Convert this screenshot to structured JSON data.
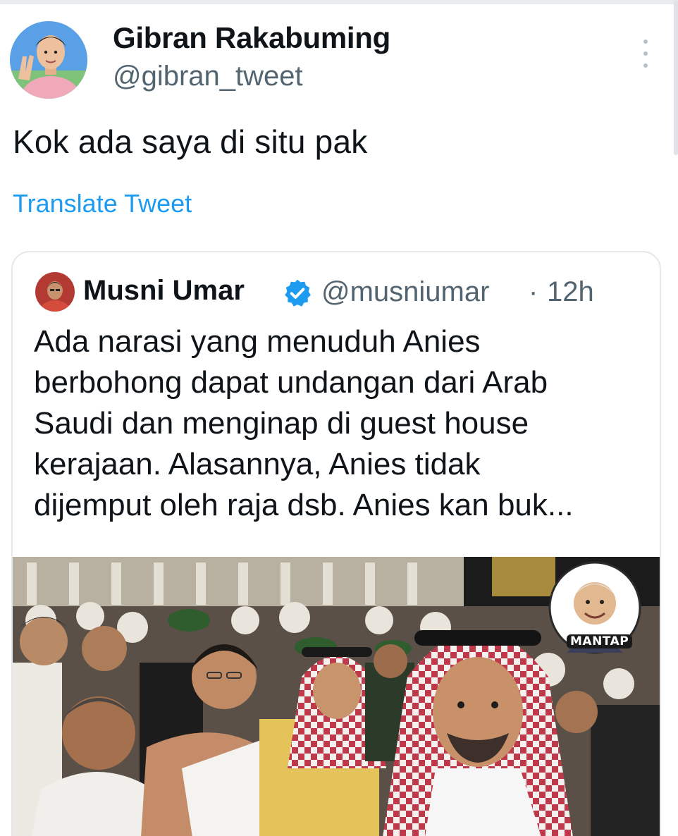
{
  "tweet": {
    "author_name": "Gibran Rakabuming",
    "author_handle": "@gibran_tweet",
    "text": "Kok ada saya di situ pak",
    "translate_label": "Translate Tweet",
    "more_icon": "more-vertical-icon"
  },
  "quoted_tweet": {
    "author_name": "Musni Umar",
    "verified_icon": "verified-badge-icon",
    "author_handle": "@musniumar",
    "separator": "·",
    "time": "12h",
    "text_lines": [
      "Ada narasi yang menuduh Anies",
      "berbohong  dapat undangan dari Arab",
      "Saudi dan menginap di guest house",
      "kerajaan.  Alasannya,  Anies tidak",
      "dijemput oleh raja dsb.  Anies kan buk..."
    ],
    "media_badge": "MANTAP"
  },
  "colors": {
    "text_primary": "#0f1419",
    "text_secondary": "#536471",
    "link": "#1d9bf0",
    "verified": "#1d9bf0",
    "border": "#e4e8eb"
  }
}
